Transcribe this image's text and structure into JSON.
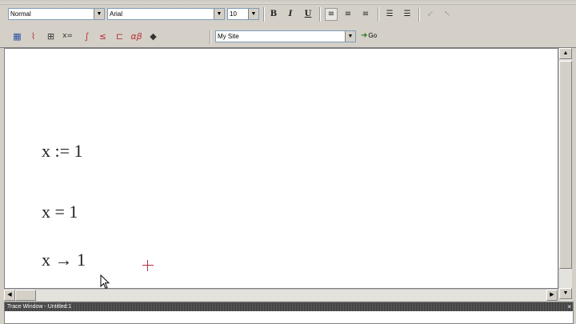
{
  "toolbar_format": {
    "style": "Normal",
    "font": "Arial",
    "size": "10",
    "bold": "B",
    "italic": "I",
    "underline": "U"
  },
  "toolbar_standard": {
    "resource": "My Site",
    "go_label": "Go"
  },
  "worksheet": {
    "line1": "x := 1",
    "line2": "x = 1",
    "line3": "x → 1"
  },
  "trace_window": {
    "title": "Trace Window - Untitled:1",
    "close": "×"
  },
  "scroll": {
    "up": "▲",
    "down": "▼",
    "left": "◀",
    "right": "▶"
  },
  "colors": {
    "cursor_cross": "#b03040",
    "workspace_bg": "#ffffff",
    "chrome_bg": "#d4d0c8"
  }
}
